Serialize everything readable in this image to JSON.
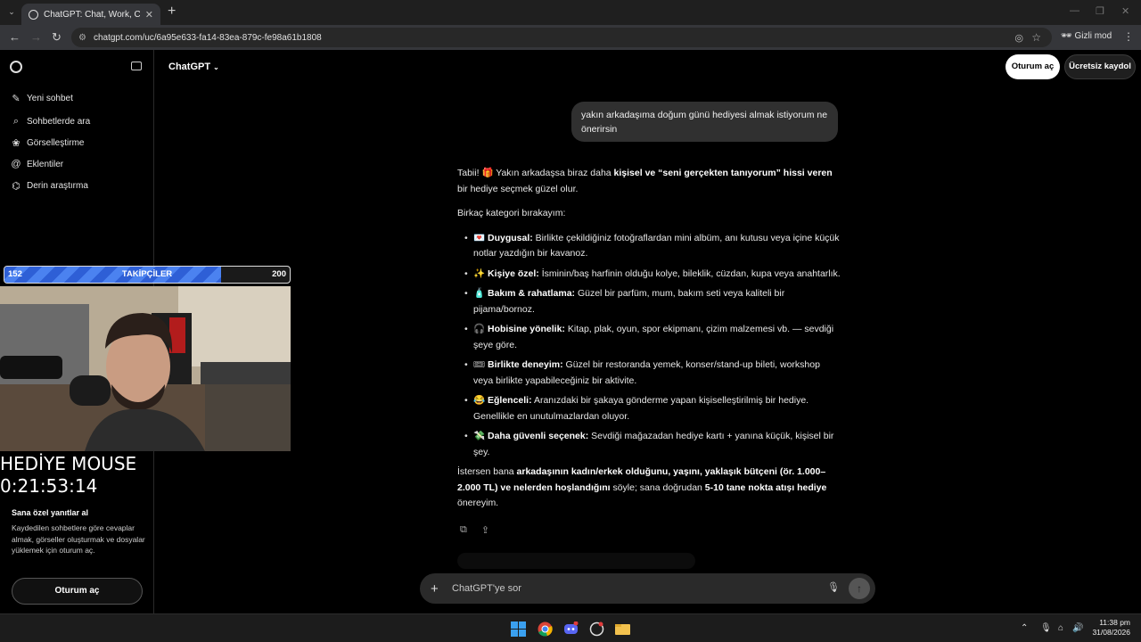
{
  "browser": {
    "tab_title": "ChatGPT: Chat, Work, Create &",
    "url": "chatgpt.com/uc/6a95e633-fa14-83ea-879c-fe98a61b1808",
    "incognito_label": "Gizli mod"
  },
  "sidebar": {
    "items": [
      {
        "label": "Yeni sohbet",
        "icon": "edit-icon"
      },
      {
        "label": "Sohbetlerde ara",
        "icon": "search-icon"
      },
      {
        "label": "Görselleştirme",
        "icon": "image-icon"
      },
      {
        "label": "Eklentiler",
        "icon": "apps-icon"
      },
      {
        "label": "Derin araştırma",
        "icon": "research-icon"
      }
    ],
    "promo_title": "Sana özel yanıtlar al",
    "promo_text": "Kaydedilen sohbetlere göre cevaplar almak, görseller oluşturmak ve dosyalar yüklemek için oturum aç.",
    "login_button": "Oturum aç"
  },
  "header": {
    "title": "ChatGPT",
    "login_button": "Oturum aç",
    "signup_button": "Ücretsiz kaydol"
  },
  "conversation": {
    "user_message": "yakın arkadaşıma doğum günü hediyesi almak istiyorum ne önerirsin",
    "intro_a": "Tabii! ",
    "intro_emoji": "🎁",
    "intro_b": " Yakın arkadaşsa biraz daha ",
    "intro_bold": "kişisel ve “seni gerçekten tanıyorum” hissi veren",
    "intro_c": " bir hediye seçmek güzel olur.",
    "categories_intro": "Birkaç kategori bırakayım:",
    "items": [
      {
        "emoji": "💌",
        "title": "Duygusal:",
        "text": " Birlikte çekildiğiniz fotoğraflardan mini albüm, anı kutusu veya içine küçük notlar yazdığın bir kavanoz."
      },
      {
        "emoji": "✨",
        "title": "Kişiye özel:",
        "text": " İsminin/baş harfinin olduğu kolye, bileklik, cüzdan, kupa veya anahtarlık."
      },
      {
        "emoji": "🧴",
        "title": "Bakım & rahatlama:",
        "text": " Güzel bir parfüm, mum, bakım seti veya kaliteli bir pijama/bornoz."
      },
      {
        "emoji": "🎧",
        "title": "Hobisine yönelik:",
        "text": " Kitap, plak, oyun, spor ekipmanı, çizim malzemesi vb. — sevdiği şeye göre."
      },
      {
        "emoji": "🎟",
        "title": "Birlikte deneyim:",
        "text": " Güzel bir restoranda yemek, konser/stand-up bileti, workshop veya birlikte yapabileceğiniz bir aktivite."
      },
      {
        "emoji": "😂",
        "title": "Eğlenceli:",
        "text": " Aranızdaki bir şakaya gönderme yapan kişiselleştirilmiş bir hediye. Genellikle en unutulmazlardan oluyor."
      },
      {
        "emoji": "💸",
        "title": "Daha güvenli seçenek:",
        "text": " Sevdiği mağazadan hediye kartı + yanına küçük, kişisel bir şey."
      }
    ],
    "outro_a": "İstersen bana ",
    "outro_bold1": "arkadaşının kadın/erkek olduğunu, yaşını, yaklaşık bütçeni (ör. 1.000–2.000 TL) ve nelerden hoşlandığını",
    "outro_b": " söyle; sana doğrudan ",
    "outro_bold2": "5-10 tane nokta atışı hediye",
    "outro_c": " önereyim."
  },
  "composer": {
    "placeholder": "ChatGPT'ye sor"
  },
  "stream_overlay": {
    "followers_current": "152",
    "followers_label": "TAKİPÇİLER",
    "followers_target": "200",
    "followers_progress": 0.76,
    "title_text": "HEDİYE MOUSE",
    "timer_text": "0:21:53:14"
  },
  "taskbar": {
    "time": "11:38 pm",
    "date": "31/08/2026"
  }
}
